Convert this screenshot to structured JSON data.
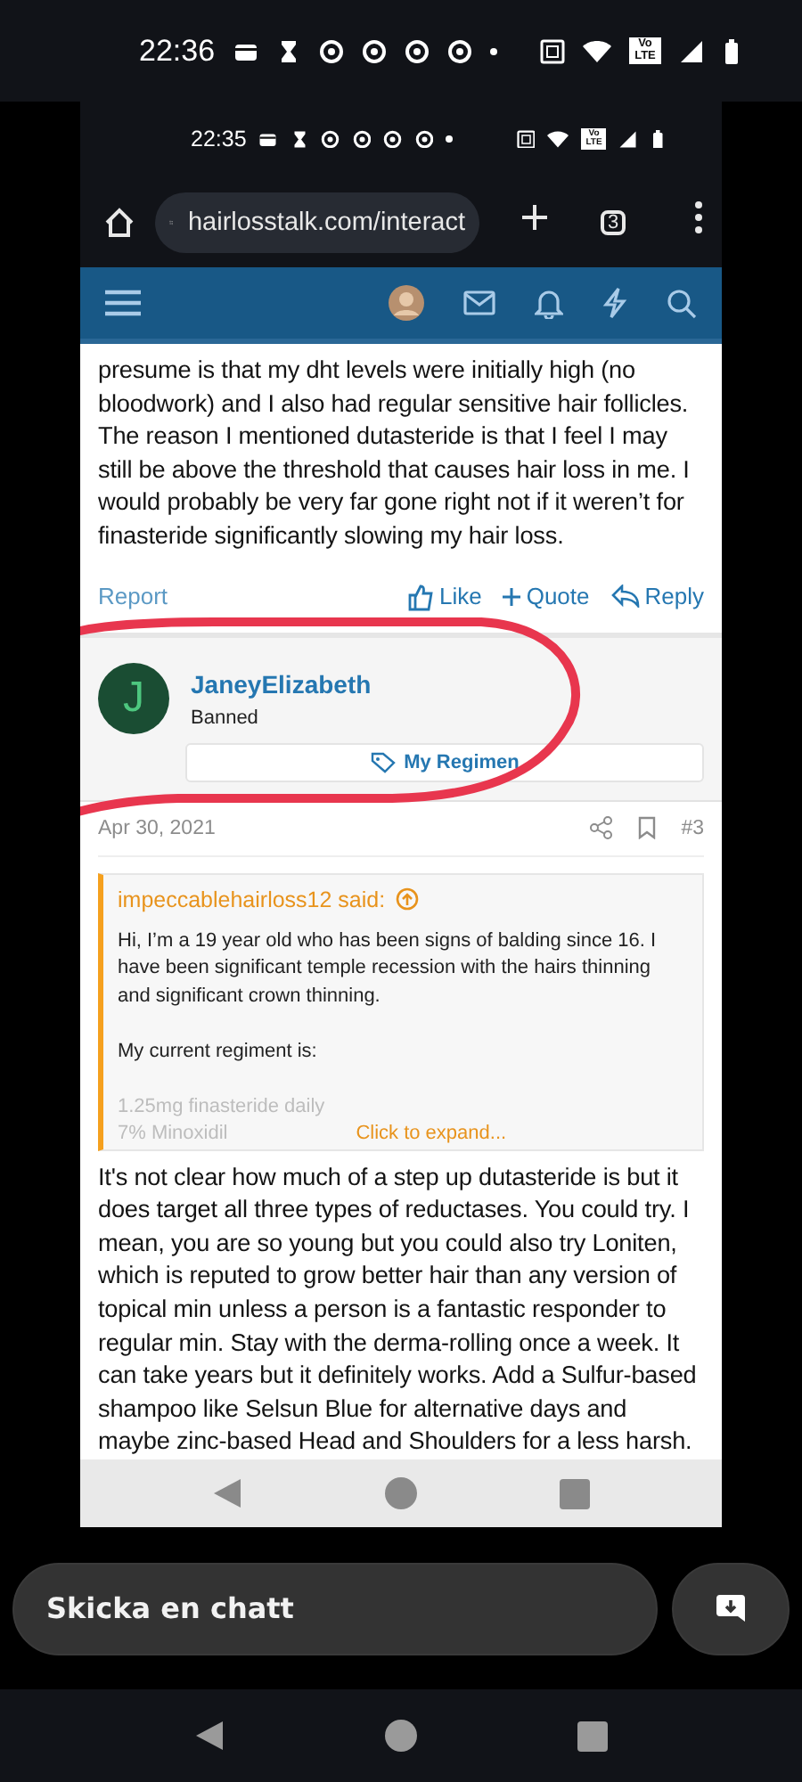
{
  "outer_status": {
    "time": "22:36",
    "network_badge": "Vo LTE"
  },
  "inner_status": {
    "time": "22:35",
    "network_badge": "Vo LTE"
  },
  "browser": {
    "url": "hairlosstalk.com/interact",
    "tab_count": "3"
  },
  "post": {
    "text": "presume is that my dht levels were initially high (no bloodwork) and I also had regular sensitive hair follicles. The reason I mentioned dutasteride is that I feel I may still be above the threshold that causes hair loss in me. I would probably be very far gone right not if it weren’t for finasteride significantly slowing my hair loss.",
    "report": "Report",
    "actions": [
      {
        "kind": "like",
        "label": "Like"
      },
      {
        "kind": "quote",
        "label": "Quote"
      },
      {
        "kind": "reply",
        "label": "Reply"
      }
    ]
  },
  "member": {
    "initial": "J",
    "name": "JaneyElizabeth",
    "title": "Banned",
    "regimen_button": "My Regimen"
  },
  "reply": {
    "date": "Apr 30, 2021",
    "number": "#3",
    "quote": {
      "author": "impeccablehairloss12 said:",
      "paragraphs": [
        "Hi, I’m a 19 year old who has been signs of balding since 16. I have been significant temple recession with the hairs thinning and significant crown thinning.",
        "My current regiment is:"
      ],
      "faded_lines": [
        "1.25mg finasteride daily",
        "7% Minoxidil"
      ],
      "expand": "Click to expand..."
    },
    "text": "It's not clear how much of a step up dutasteride is but it does target all three types of reductases. You could try. I mean, you are so young but you could also try Loniten, which is reputed to grow better hair than any version of topical min unless a person is a fantastic responder to regular min. Stay with the derma-rolling once a week. It can take years but it definitely works. Add a Sulfur-based shampoo like Selsun Blue for alternative days and maybe zinc-based Head and Shoulders for a less harsh."
  },
  "chat": {
    "placeholder": "Skicka en chatt"
  }
}
